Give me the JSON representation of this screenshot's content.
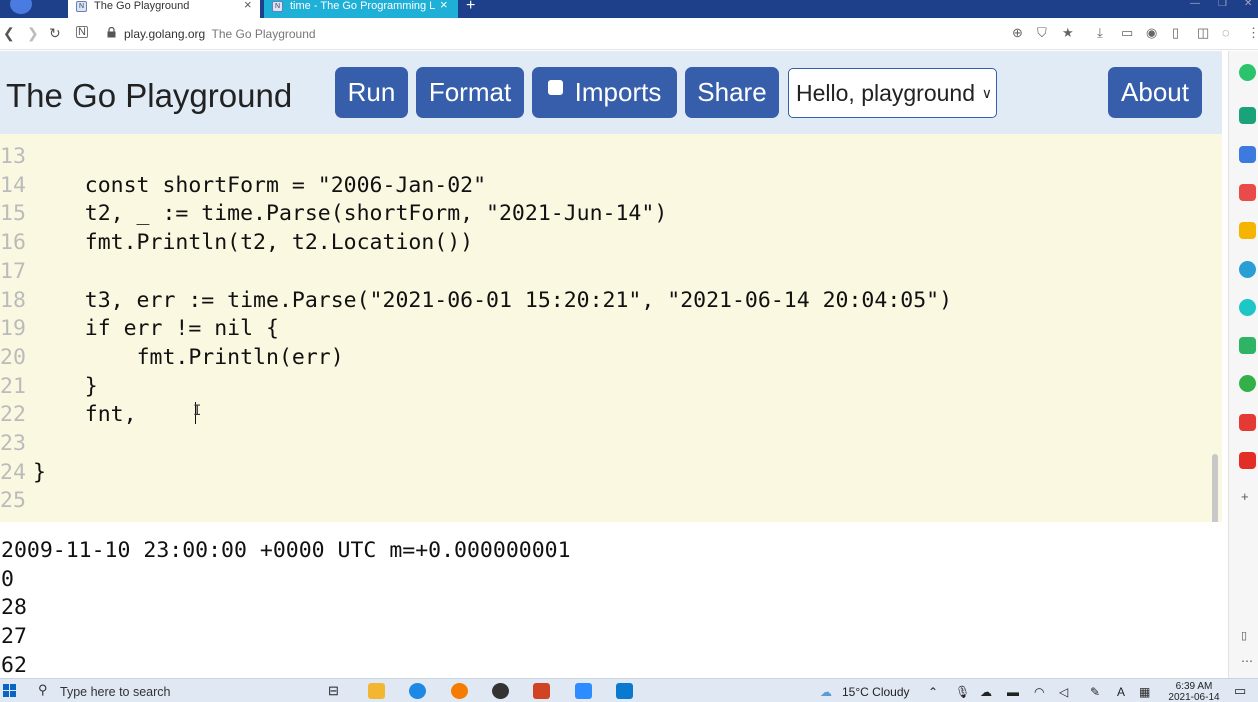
{
  "browser": {
    "tabs": [
      {
        "title": "The Go Playground",
        "favicon": "N"
      },
      {
        "title": "time - The Go Programming La",
        "favicon": "N"
      }
    ],
    "new_tab": "+",
    "url_domain": "play.golang.org",
    "url_title": "The Go Playground",
    "close_glyph": "×"
  },
  "header": {
    "title": "The Go Playground",
    "run": "Run",
    "format": "Format",
    "imports": "Imports",
    "share": "Share",
    "example_selected": "Hello, playground",
    "about": "About"
  },
  "editor": {
    "lines": [
      {
        "n": "13",
        "text": ""
      },
      {
        "n": "14",
        "text": "\tconst shortForm = \"2006-Jan-02\""
      },
      {
        "n": "15",
        "text": "\tt2, _ := time.Parse(shortForm, \"2021-Jun-14\")"
      },
      {
        "n": "16",
        "text": "\tfmt.Println(t2, t2.Location())"
      },
      {
        "n": "17",
        "text": ""
      },
      {
        "n": "18",
        "text": "\tt3, err := time.Parse(\"2021-06-01 15:20:21\", \"2021-06-14 20:04:05\")"
      },
      {
        "n": "19",
        "text": "\tif err != nil {"
      },
      {
        "n": "20",
        "text": "\t\tfmt.Println(err)"
      },
      {
        "n": "21",
        "text": "\t}"
      },
      {
        "n": "22",
        "text": "\tfnt,"
      },
      {
        "n": "23",
        "text": ""
      },
      {
        "n": "24",
        "text": "}"
      },
      {
        "n": "25",
        "text": ""
      }
    ]
  },
  "output": {
    "lines": [
      "2009-11-10 23:00:00 +0000 UTC m=+0.000000001",
      "0",
      "28",
      "27",
      "62"
    ]
  },
  "taskbar": {
    "search_placeholder": "Type here to search",
    "weather": "15°C  Cloudy",
    "time": "6:39 AM",
    "date": "2021-06-14"
  },
  "colors": {
    "header_bg": "#e0ebf5",
    "button_bg": "#375eab",
    "editor_bg": "#fbf8e1",
    "tab_strip": "#1e3f8a",
    "active_tab2": "#1fb0d8"
  }
}
